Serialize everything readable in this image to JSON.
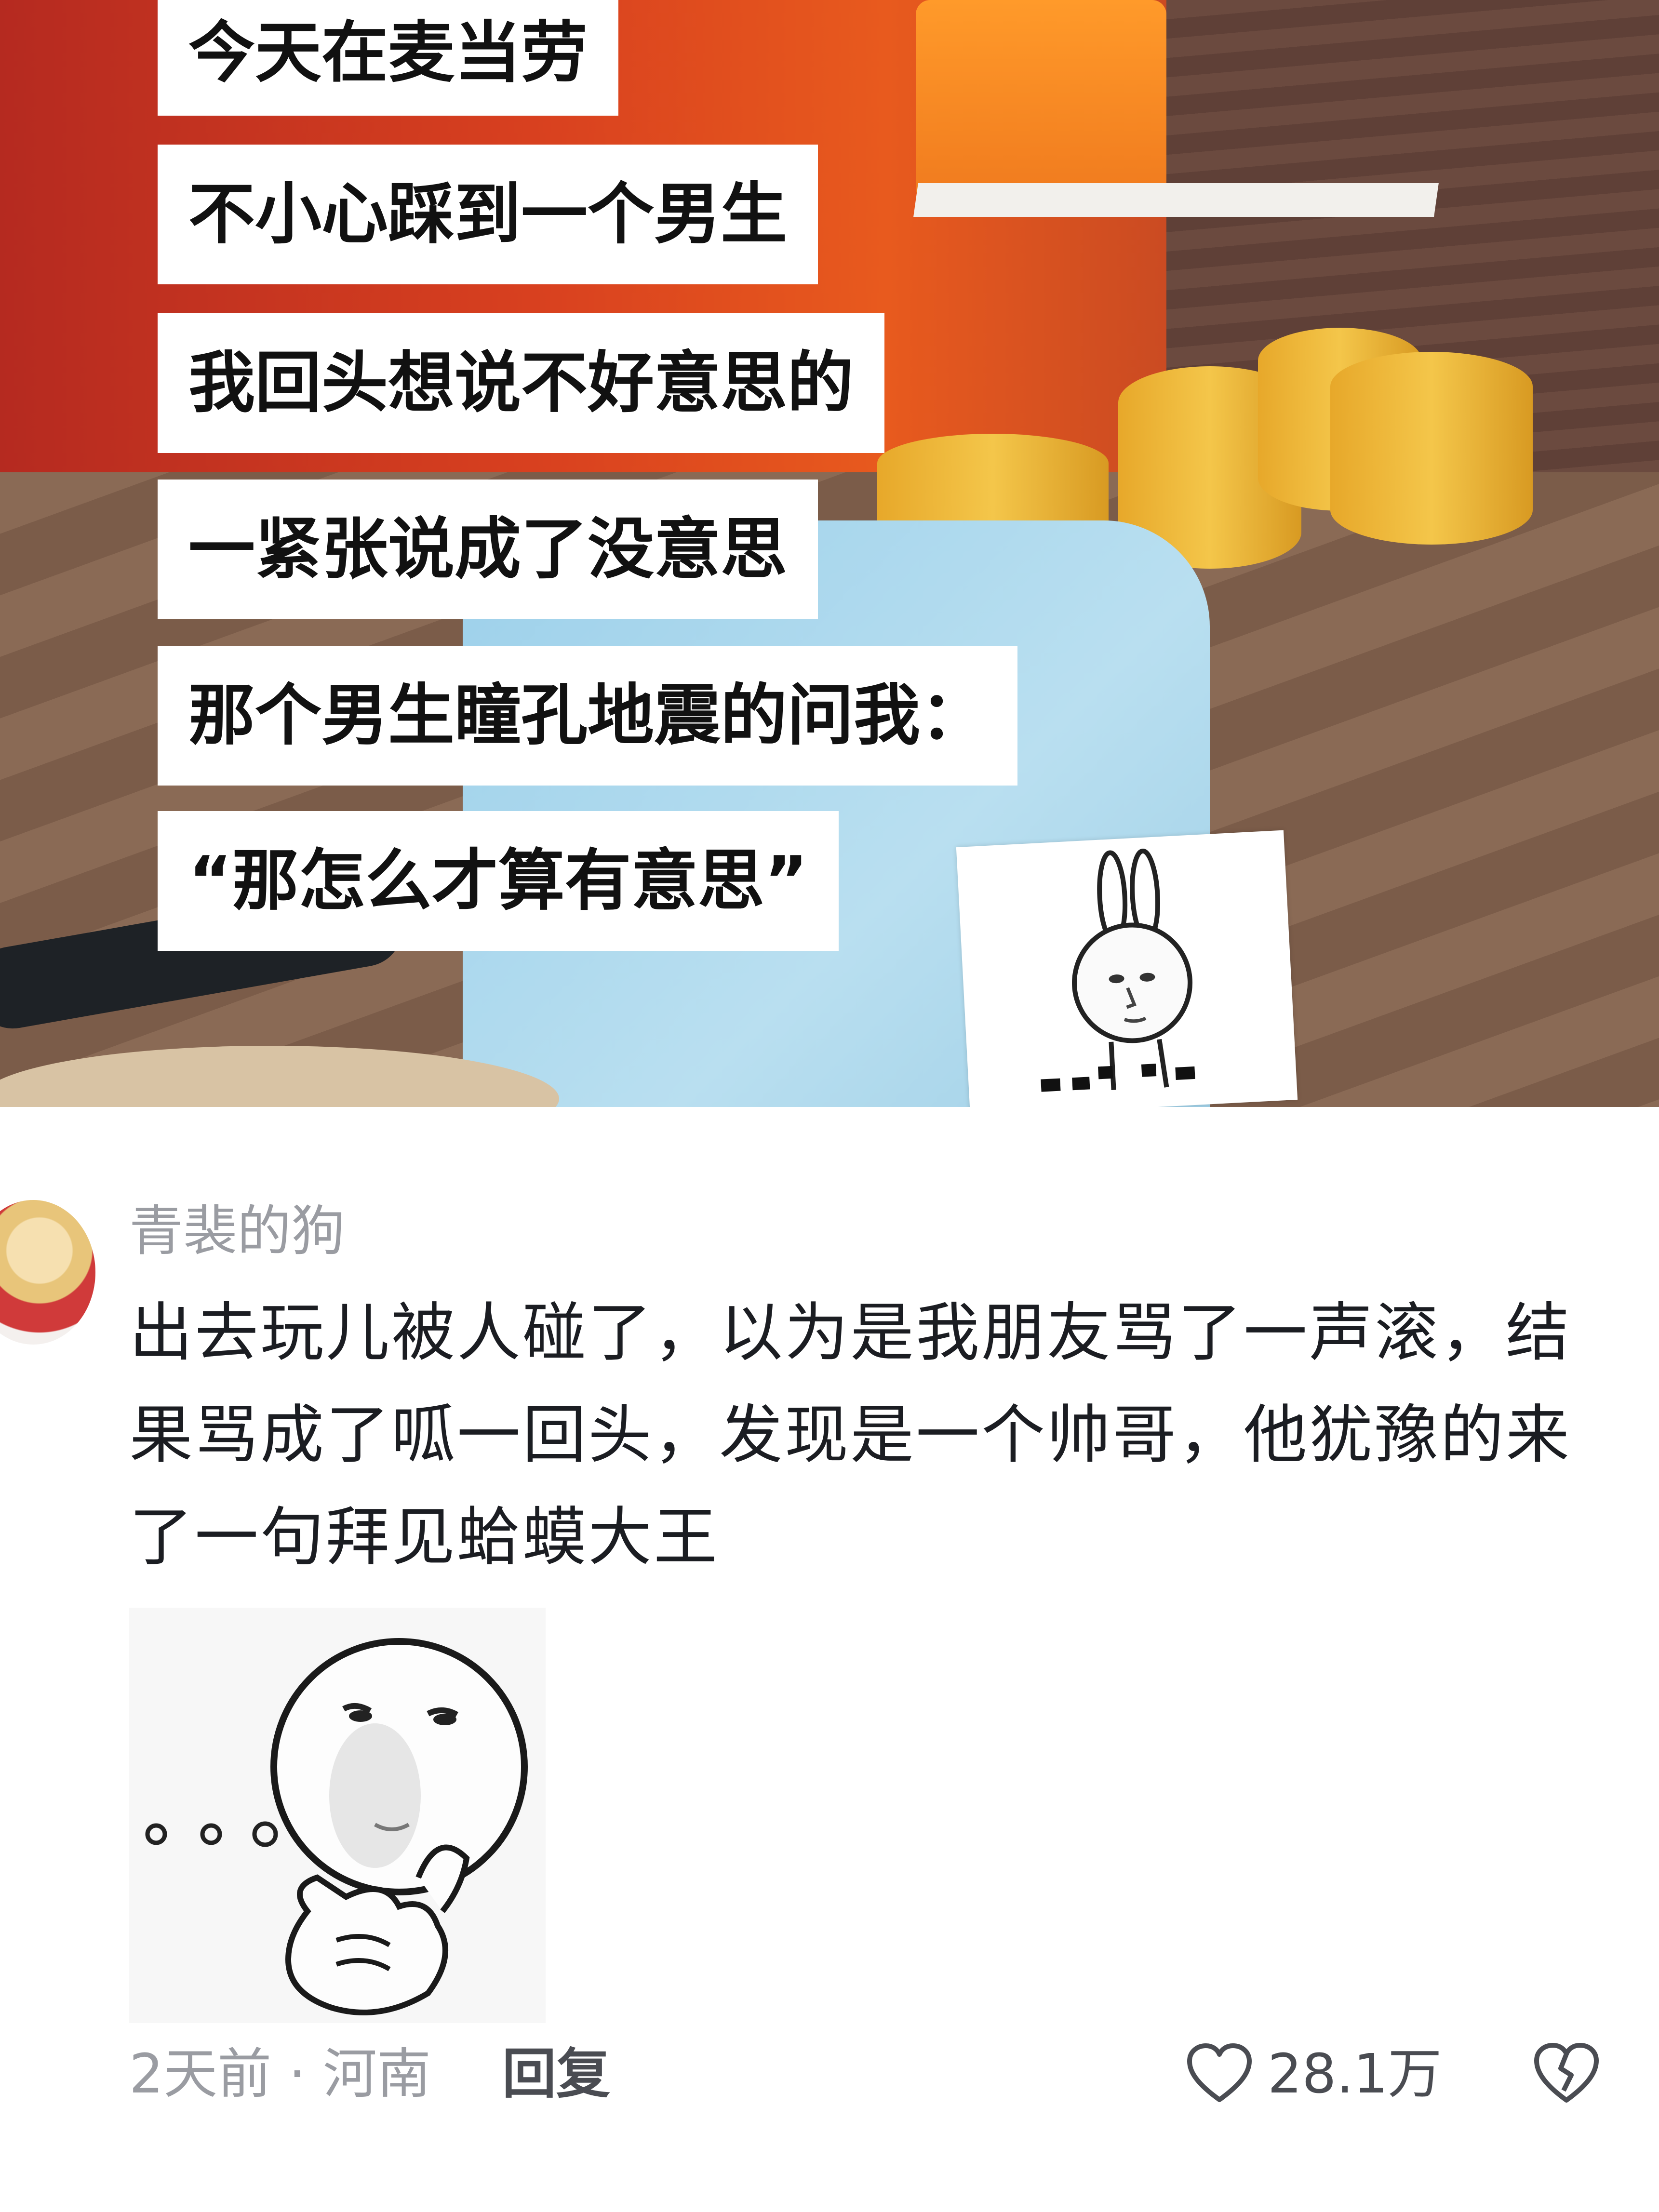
{
  "video": {
    "caption_lines": [
      "今天在麦当劳",
      "不小心踩到一个男生",
      "我回头想说不好意思的",
      "一紧张说成了没意思",
      "那个男生瞳孔地震的问我：",
      "“那怎么才算有意思”"
    ],
    "sticker": "rabbit-face-sticker"
  },
  "comment": {
    "username": "青裴的狗",
    "text": "出去玩儿被人碰了，以为是我朋友骂了一声滚，结果骂成了呱一回头，发现是一个帅哥，他犹豫的来了一句拜见蛤蟆大王",
    "meme": "thinking-face-meme",
    "time_location": "2天前 · 河南",
    "reply_label": "回复",
    "like_count": "28.1万",
    "like_icon": "heart-outline-icon",
    "dislike_icon": "broken-heart-icon"
  }
}
